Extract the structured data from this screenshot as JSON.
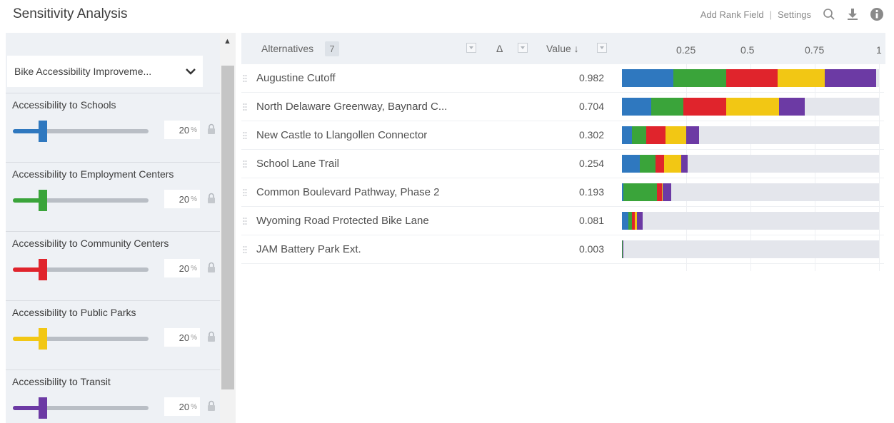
{
  "header": {
    "title": "Sensitivity Analysis",
    "add_rank_field": "Add Rank Field",
    "separator": "|",
    "settings": "Settings",
    "icons": [
      "search-icon",
      "download-icon",
      "info-icon"
    ]
  },
  "sidebar": {
    "dropdown_value": "Bike Accessibility Improveme...",
    "criteria": [
      {
        "label": "Accessibility to Schools",
        "weight": 20,
        "unit": "%",
        "color": "#2f78bf"
      },
      {
        "label": "Accessibility to Employment Centers",
        "weight": 20,
        "unit": "%",
        "color": "#3aa43a"
      },
      {
        "label": "Accessibility to Community Centers",
        "weight": 20,
        "unit": "%",
        "color": "#e0242c"
      },
      {
        "label": "Accessibility to Public Parks",
        "weight": 20,
        "unit": "%",
        "color": "#f2c714"
      },
      {
        "label": "Accessibility to Transit",
        "weight": 20,
        "unit": "%",
        "color": "#6c3aa4"
      }
    ]
  },
  "table": {
    "alternatives_label": "Alternatives",
    "alternatives_count": "7",
    "delta_label": "Δ",
    "value_label": "Value ↓",
    "axis_ticks": [
      "0.25",
      "0.5",
      "0.75",
      "1"
    ],
    "axis_max": 1
  },
  "chart_data": {
    "type": "bar",
    "stacked": true,
    "orientation": "horizontal",
    "xlim": [
      0,
      1
    ],
    "ticks": [
      0.25,
      0.5,
      0.75,
      1
    ],
    "series_colors": [
      "#2f78bf",
      "#3aa43a",
      "#e0242c",
      "#f2c714",
      "#6c3aa4"
    ],
    "rows": [
      {
        "name": "Augustine Cutoff",
        "value": "0.982",
        "segments": [
          0.2,
          0.205,
          0.2,
          0.185,
          0.2
        ]
      },
      {
        "name": "North Delaware Greenway, Baynard C...",
        "value": "0.704",
        "segments": [
          0.115,
          0.125,
          0.165,
          0.205,
          0.1
        ]
      },
      {
        "name": "New Castle to Llangollen Connector",
        "value": "0.302",
        "segments": [
          0.04,
          0.055,
          0.075,
          0.08,
          0.05
        ]
      },
      {
        "name": "School Lane Trail",
        "value": "0.254",
        "segments": [
          0.07,
          0.06,
          0.035,
          0.065,
          0.025
        ]
      },
      {
        "name": "Common Boulevard Pathway, Phase 2",
        "value": "0.193",
        "segments": [
          0.005,
          0.13,
          0.02,
          0.002,
          0.036
        ]
      },
      {
        "name": "Wyoming Road Protected Bike Lane",
        "value": "0.081",
        "segments": [
          0.025,
          0.015,
          0.01,
          0.008,
          0.023
        ]
      },
      {
        "name": "JAM Battery Park Ext.",
        "value": "0.003",
        "segments": [
          0.001,
          0.001,
          0.0,
          0.0,
          0.001
        ]
      }
    ]
  }
}
